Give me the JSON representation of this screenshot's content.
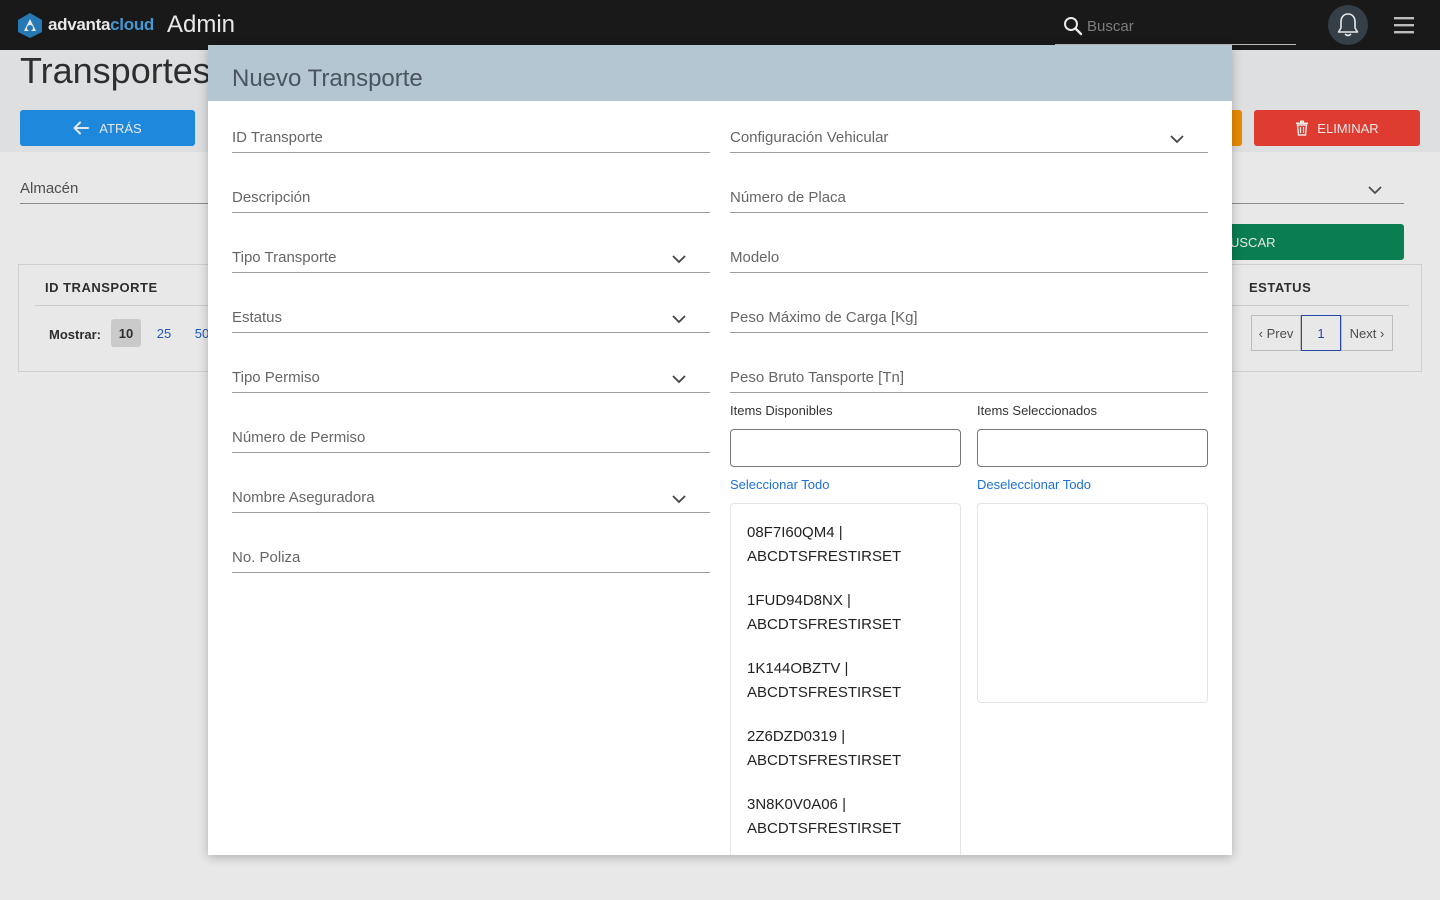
{
  "navbar": {
    "logo_text_a": "advanta",
    "logo_text_b": "cloud",
    "app_title": "Admin",
    "search_placeholder": "Buscar"
  },
  "background": {
    "page_title": "Transportes",
    "back_button": "ATRÁS",
    "delete_button": "ELIMINAR",
    "almacen_label": "Almacén",
    "search_button": "USCAR",
    "columns": [
      "ID TRANSPORTE",
      "ESTATUS"
    ],
    "mostrar_label": "Mostrar:",
    "page_sizes": [
      "10",
      "25",
      "50"
    ],
    "pager": {
      "prev": "‹ Prev",
      "current": "1",
      "next": "Next ›"
    }
  },
  "modal": {
    "title": "Nuevo Transporte",
    "fields_left": [
      {
        "label": "ID Transporte",
        "dropdown": false
      },
      {
        "label": "Descripción",
        "dropdown": false
      },
      {
        "label": "Tipo Transporte",
        "dropdown": true
      },
      {
        "label": "Estatus",
        "dropdown": true
      },
      {
        "label": "Tipo Permiso",
        "dropdown": true
      },
      {
        "label": "Número de Permiso",
        "dropdown": false
      },
      {
        "label": "Nombre Aseguradora",
        "dropdown": true
      },
      {
        "label": "No. Poliza",
        "dropdown": false
      }
    ],
    "fields_right": [
      {
        "label": "Configuración Vehicular",
        "dropdown": true
      },
      {
        "label": "Número de Placa",
        "dropdown": false
      },
      {
        "label": "Modelo",
        "dropdown": false
      },
      {
        "label": "Peso Máximo de Carga [Kg]",
        "dropdown": false
      },
      {
        "label": "Peso Bruto Tansporte [Tn]",
        "dropdown": false
      }
    ],
    "picklist": {
      "available_label": "Items Disponibles",
      "selected_label": "Items Seleccionados",
      "select_all": "Seleccionar Todo",
      "deselect_all": "Deseleccionar Todo",
      "available_items": [
        {
          "line1": "08F7I60QM4 |",
          "line2": "ABCDTSFRESTIRSET"
        },
        {
          "line1": "1FUD94D8NX |",
          "line2": "ABCDTSFRESTIRSET"
        },
        {
          "line1": "1K144OBZTV |",
          "line2": "ABCDTSFRESTIRSET"
        },
        {
          "line1": "2Z6DZD0319 |",
          "line2": "ABCDTSFRESTIRSET"
        },
        {
          "line1": "3N8K0V0A06 |",
          "line2": "ABCDTSFRESTIRSET"
        }
      ]
    }
  },
  "colors": {
    "navbar_bg": "#1c1c1c",
    "modal_header": "#b4c6d2",
    "primary": "#2196f3",
    "danger": "#f44336",
    "success": "#0b8a5a",
    "link": "#1e70d8"
  }
}
